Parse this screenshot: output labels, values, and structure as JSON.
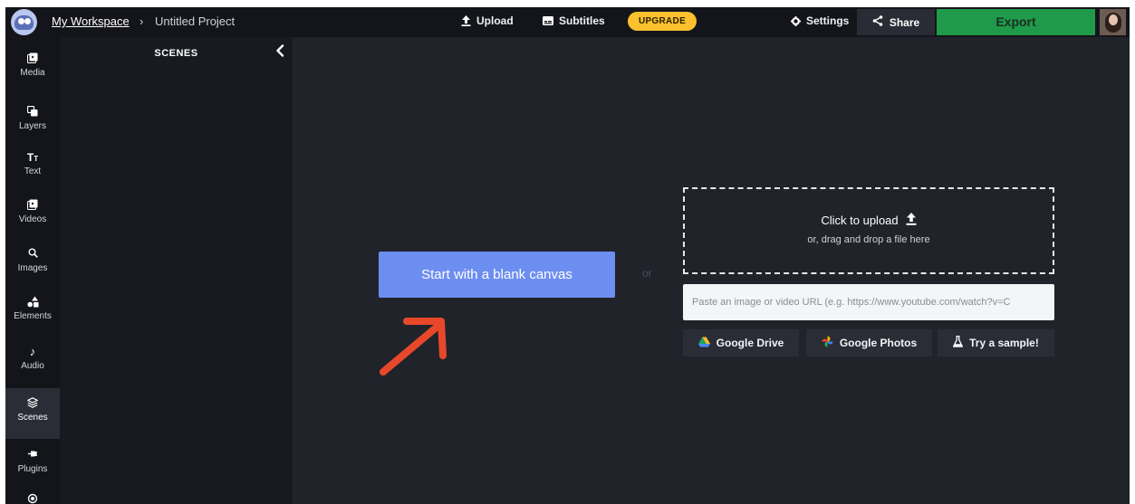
{
  "header": {
    "breadcrumb_workspace": "My Workspace",
    "breadcrumb_separator": "›",
    "breadcrumb_project": "Untitled Project",
    "upload_label": "Upload",
    "subtitles_label": "Subtitles",
    "upgrade_label": "UPGRADE",
    "settings_label": "Settings",
    "share_label": "Share",
    "export_label": "Export"
  },
  "sidebar": {
    "items": [
      {
        "label": "Media",
        "icon": "media-icon"
      },
      {
        "label": "Layers",
        "icon": "layers-icon"
      },
      {
        "label": "Text",
        "icon": "text-icon"
      },
      {
        "label": "Videos",
        "icon": "videos-icon"
      },
      {
        "label": "Images",
        "icon": "search-icon"
      },
      {
        "label": "Elements",
        "icon": "elements-icon"
      },
      {
        "label": "Audio",
        "icon": "music-note-icon"
      },
      {
        "label": "Scenes",
        "icon": "stack-icon",
        "active": true
      },
      {
        "label": "Plugins",
        "icon": "plug-icon"
      }
    ]
  },
  "scenes_panel": {
    "title": "SCENES"
  },
  "main": {
    "blank_canvas_label": "Start with a blank canvas",
    "or_label": "or",
    "upload_main": "Click to upload",
    "upload_sub": "or, drag and drop a file here",
    "url_placeholder": "Paste an image or video URL (e.g. https://www.youtube.com/watch?v=C",
    "google_drive_label": "Google Drive",
    "google_photos_label": "Google Photos",
    "try_sample_label": "Try a sample!"
  },
  "colors": {
    "accent_blue": "#6d8ef1",
    "export_green": "#1f9a4a",
    "upgrade_yellow": "#fbc02d",
    "annotation_arrow": "#e8482a"
  }
}
